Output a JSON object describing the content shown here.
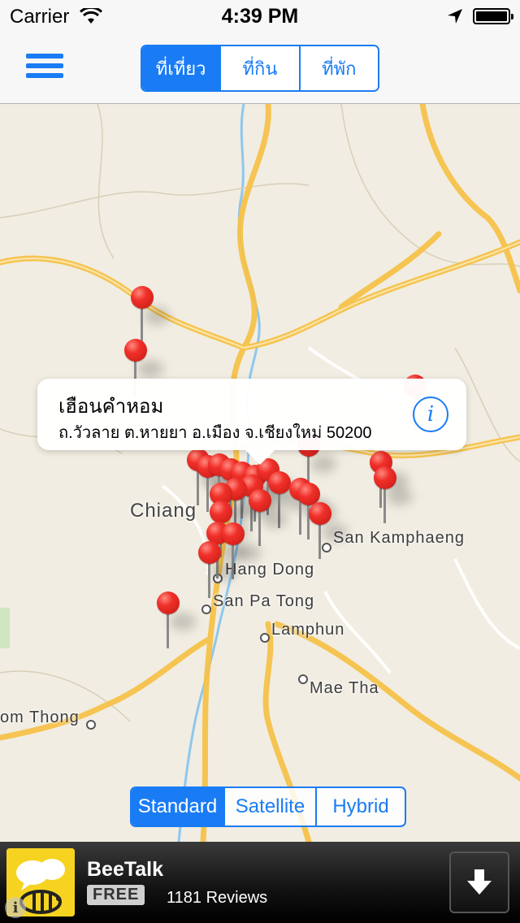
{
  "status_bar": {
    "carrier": "Carrier",
    "time": "4:39 PM"
  },
  "nav": {
    "menu_icon": "hamburger-icon",
    "tabs": [
      {
        "label": "ที่เที่ยว",
        "active": true
      },
      {
        "label": "ที่กิน",
        "active": false
      },
      {
        "label": "ที่พัก",
        "active": false
      }
    ],
    "accent_color": "#1a7cf5"
  },
  "map": {
    "places": {
      "chiang_mai": "Chiang",
      "san_kamphaeng": "San Kamphaeng",
      "hang_dong": "Hang Dong",
      "san_pa_tong": "San Pa Tong",
      "lamphun": "Lamphun",
      "mae_tha": "Mae Tha",
      "chom_thong": "om Thong"
    },
    "callout": {
      "title": "เฮือนคำหอม",
      "subtitle": "ถ.วัวลาย ต.หายยา อ.เมือง จ.เชียงใหม่ 50200",
      "info_icon": "i"
    },
    "map_types": [
      {
        "label": "Standard",
        "active": true
      },
      {
        "label": "Satellite",
        "active": false
      },
      {
        "label": "Hybrid",
        "active": false
      }
    ],
    "pin_color": "#f0302a"
  },
  "ad": {
    "app_name": "BeeTalk",
    "price": "FREE",
    "reviews": "1181 Reviews",
    "download_icon": "download-arrow-icon",
    "info_icon": "i"
  }
}
